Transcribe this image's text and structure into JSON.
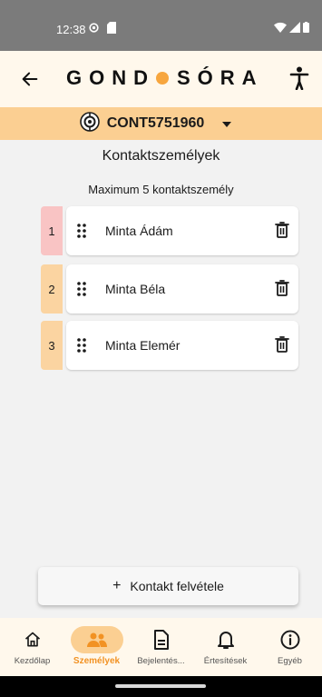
{
  "status_bar": {
    "time": "12:38"
  },
  "app_bar": {
    "logo_left": "GOND",
    "logo_right": "SÓRA",
    "logo_dot_color": "#f7a63e"
  },
  "device_selector": {
    "label": "CONT5751960"
  },
  "page": {
    "title": "Kontaktszemélyek",
    "subtitle": "Maximum 5 kontaktszemély"
  },
  "contacts": [
    {
      "index": "1",
      "name": "Minta Ádám",
      "color": "#f9c4c4"
    },
    {
      "index": "2",
      "name": "Minta Béla",
      "color": "#fbd4a1"
    },
    {
      "index": "3",
      "name": "Minta Elemér",
      "color": "#fbd4a1"
    }
  ],
  "add_button": {
    "plus": "+",
    "label": "Kontakt felvétele"
  },
  "bottom_nav": [
    {
      "label": "Kezdőlap",
      "icon": "home-icon",
      "active": false
    },
    {
      "label": "Személyek",
      "icon": "people-icon",
      "active": true
    },
    {
      "label": "Bejelentés...",
      "icon": "document-icon",
      "active": false
    },
    {
      "label": "Értesítések",
      "icon": "bell-icon",
      "active": false
    },
    {
      "label": "Egyéb",
      "icon": "info-icon",
      "active": false
    }
  ],
  "colors": {
    "accent": "#f29223",
    "selector_bg": "#fbcf92",
    "header_bg": "#fff8ec"
  }
}
